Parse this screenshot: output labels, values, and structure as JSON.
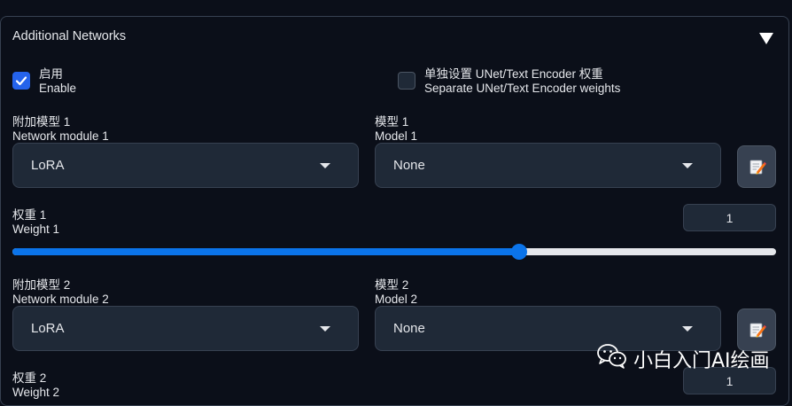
{
  "panel": {
    "title": "Additional Networks"
  },
  "options": {
    "enable": {
      "label_cn": "启用",
      "label_en": "Enable",
      "checked": true
    },
    "separate_weights": {
      "label_cn": "单独设置 UNet/Text Encoder 权重",
      "label_en": "Separate UNet/Text Encoder weights",
      "checked": false
    }
  },
  "slots": [
    {
      "module_label_cn": "附加模型 1",
      "module_label_en": "Network module 1",
      "module_value": "LoRA",
      "model_label_cn": "模型 1",
      "model_label_en": "Model 1",
      "model_value": "None",
      "weight_label_cn": "权重 1",
      "weight_label_en": "Weight 1",
      "weight_value": "1",
      "slider_fraction": 0.664
    },
    {
      "module_label_cn": "附加模型 2",
      "module_label_en": "Network module 2",
      "module_value": "LoRA",
      "model_label_cn": "模型 2",
      "model_label_en": "Model 2",
      "model_value": "None",
      "weight_label_cn": "权重 2",
      "weight_label_en": "Weight 2",
      "weight_value": "1"
    }
  ],
  "icons": {
    "refresh": "edit-refresh-icon",
    "collapse": "triangle-down-icon",
    "watermark": "wechat-icon"
  },
  "colors": {
    "accent": "#0b74ea",
    "checkbox": "#2563eb",
    "background": "#0b0f19"
  },
  "watermark": {
    "text": "小白入门AI绘画"
  }
}
